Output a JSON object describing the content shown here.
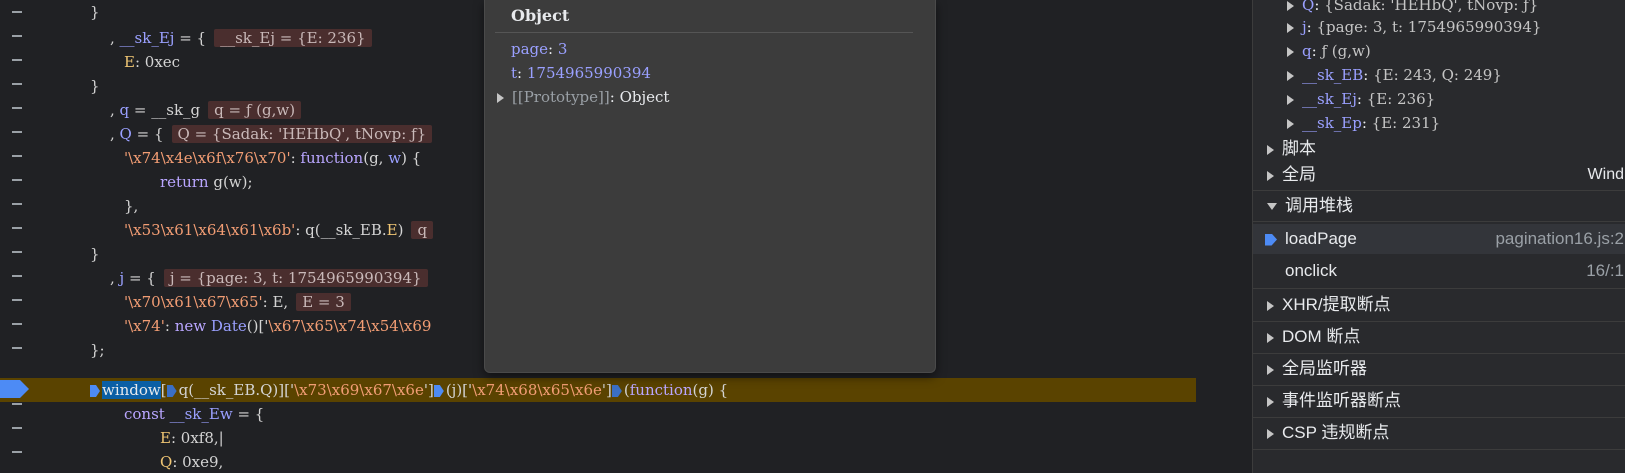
{
  "editor": {
    "lines": [
      {
        "id": "l1",
        "tokens": [
          [
            "plain",
            "}"
          ]
        ]
      },
      {
        "id": "l2",
        "tokens": [
          [
            "plain",
            ", "
          ],
          [
            "var",
            "__sk_Ej"
          ],
          [
            "plain",
            " = {"
          ]
        ],
        "inline": "__sk_Ej = {E: 236}"
      },
      {
        "id": "l3",
        "tokens": [
          [
            "prop",
            "E"
          ],
          [
            "plain",
            ": "
          ],
          [
            "plain",
            "0xec"
          ]
        ]
      },
      {
        "id": "l4",
        "tokens": [
          [
            "plain",
            "}"
          ]
        ]
      },
      {
        "id": "l5",
        "tokens": [
          [
            "plain",
            ", "
          ],
          [
            "var",
            "q"
          ],
          [
            "plain",
            " = __sk_g"
          ]
        ],
        "inline": "q = ƒ (g,w)"
      },
      {
        "id": "l6",
        "tokens": [
          [
            "plain",
            ", "
          ],
          [
            "var",
            "Q"
          ],
          [
            "plain",
            " = {"
          ]
        ],
        "inline": "Q = {Sadak: 'HEHbQ', tNovp: ƒ}"
      },
      {
        "id": "l7",
        "tokens": [
          [
            "str",
            "'\\x74\\x4e\\x6f\\x76\\x70'"
          ],
          [
            "plain",
            ": "
          ],
          [
            "kw",
            "function"
          ],
          [
            "plain",
            "(g, "
          ],
          [
            "var",
            "w"
          ],
          [
            "plain",
            ") {"
          ]
        ]
      },
      {
        "id": "l8",
        "tokens": [
          [
            "kw",
            "return"
          ],
          [
            "plain",
            " g(w);"
          ]
        ]
      },
      {
        "id": "l9",
        "tokens": [
          [
            "plain",
            "},"
          ]
        ]
      },
      {
        "id": "l10",
        "tokens": [
          [
            "str",
            "'\\x53\\x61\\x64\\x61\\x6b'"
          ],
          [
            "plain",
            ": q(__sk_EB."
          ],
          [
            "prop",
            "E"
          ],
          [
            "plain",
            ")"
          ]
        ],
        "inline": "q"
      },
      {
        "id": "l11",
        "tokens": [
          [
            "plain",
            "}"
          ]
        ]
      },
      {
        "id": "l12",
        "tokens": [
          [
            "plain",
            ", "
          ],
          [
            "var",
            "j"
          ],
          [
            "plain",
            " = {"
          ]
        ],
        "inline": "j = {page: 3, t: 1754965990394}"
      },
      {
        "id": "l13",
        "tokens": [
          [
            "str",
            "'\\x70\\x61\\x67\\x65'"
          ],
          [
            "plain",
            ": E,"
          ]
        ],
        "inline": "E = 3"
      },
      {
        "id": "l14",
        "tokens": [
          [
            "str",
            "'\\x74'"
          ],
          [
            "plain",
            ": "
          ],
          [
            "kw",
            "new"
          ],
          [
            "plain",
            " "
          ],
          [
            "var",
            "Date"
          ],
          [
            "plain",
            "()['"
          ],
          [
            "str",
            "\\x67\\x65\\x74\\x54\\x69"
          ]
        ]
      },
      {
        "id": "l15",
        "tokens": [
          [
            "plain",
            "};"
          ]
        ]
      },
      {
        "id": "l16",
        "tokens": []
      },
      {
        "id": "l17",
        "tokens": [
          [
            "kw",
            "const"
          ],
          [
            "plain",
            " "
          ],
          [
            "var",
            "__sk_Ew"
          ],
          [
            "plain",
            " = {"
          ]
        ]
      },
      {
        "id": "l18",
        "tokens": [
          [
            "prop",
            "E"
          ],
          [
            "plain",
            ": 0xf8,|"
          ]
        ]
      },
      {
        "id": "l19",
        "tokens": [
          [
            "prop",
            "Q"
          ],
          [
            "plain",
            ": 0xe9,"
          ]
        ]
      }
    ],
    "active_line": {
      "window": "window",
      "t1": "[",
      "t2": "q(__sk_EB.Q)",
      "t3": "]['",
      "s1": "\\x73\\x69\\x67\\x6e",
      "t4": "']",
      "t5": "(j)['",
      "s2": "\\x74\\x68\\x65\\x6e",
      "t6": "']",
      "t7": "(",
      "kw": "function",
      "t8": "(g) {"
    }
  },
  "popover": {
    "title": "Object",
    "rows": [
      {
        "key": "page",
        "value": "3"
      },
      {
        "key": "t",
        "value": "1754965990394"
      }
    ],
    "proto_key": "[[Prototype]]",
    "proto_val": "Object"
  },
  "scope": {
    "items": [
      {
        "key": "Q",
        "value": "{Sadak: 'HEHbQ', tNovp: ƒ}"
      },
      {
        "key": "j",
        "value": "{page: 3, t: 1754965990394}"
      },
      {
        "key": "q",
        "value": "ƒ (g,w)"
      },
      {
        "key": "__sk_EB",
        "value": "{E: 243, Q: 249}"
      },
      {
        "key": "__sk_Ej",
        "value": "{E: 236}"
      },
      {
        "key": "__sk_Ep",
        "value": "{E: 231}"
      }
    ],
    "script_label": "脚本",
    "global_label": "全局",
    "global_value": "Wind"
  },
  "callstack": {
    "header": "调用堆栈",
    "frames": [
      {
        "name": "loadPage",
        "loc": "pagination16.js:2"
      },
      {
        "name": "onclick",
        "loc": "16/:1"
      }
    ]
  },
  "sections": [
    {
      "label": "XHR/提取断点"
    },
    {
      "label": "DOM 断点"
    },
    {
      "label": "全局监听器"
    },
    {
      "label": "事件监听器断点"
    },
    {
      "label": "CSP 违规断点"
    }
  ],
  "colors": {
    "accent": "#4d8bf5",
    "active_line_bg": "#5a4300",
    "inline_value_bg": "#4a2e2e"
  }
}
